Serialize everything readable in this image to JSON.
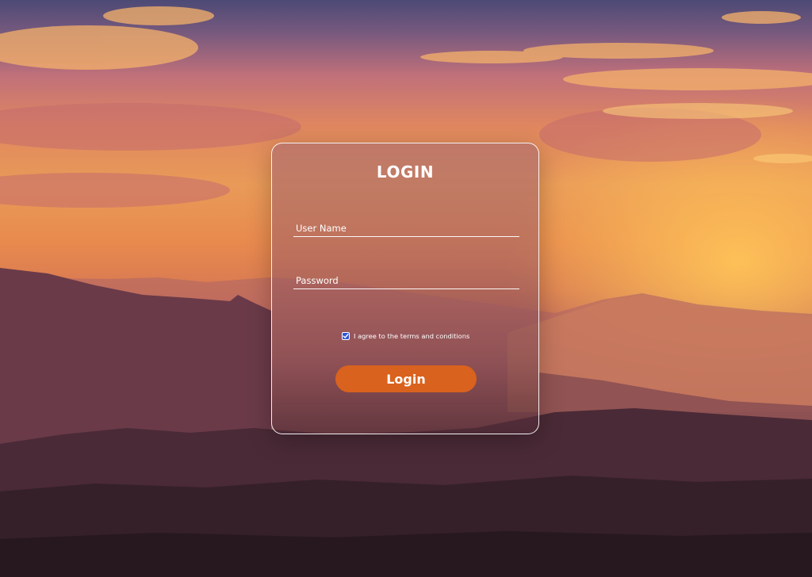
{
  "login": {
    "title": "LOGIN",
    "username_placeholder": "User Name",
    "password_placeholder": "Password",
    "terms_label": "I agree to the terms and conditions",
    "terms_checked": true,
    "submit_label": "Login"
  },
  "colors": {
    "button": "#d9621e",
    "checkbox": "#2f55d4",
    "card_border": "#ffffff"
  }
}
